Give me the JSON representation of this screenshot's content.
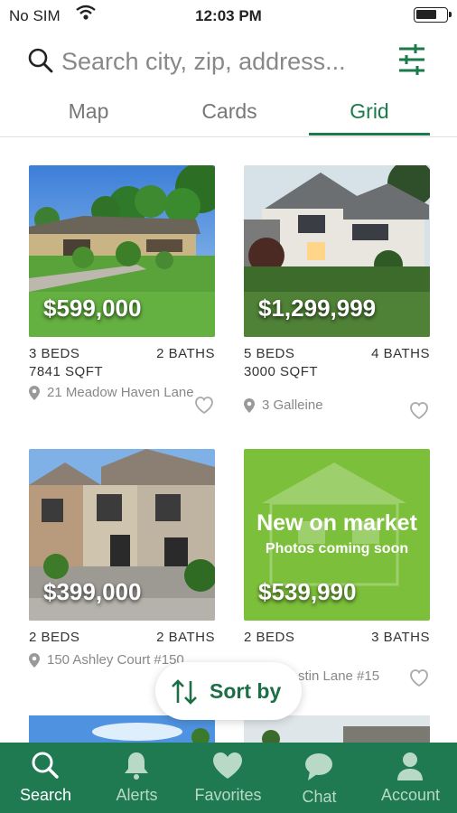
{
  "status_bar": {
    "carrier": "No SIM",
    "time": "12:03 PM"
  },
  "search": {
    "placeholder": "Search city, zip, address..."
  },
  "tabs": [
    {
      "label": "Map",
      "active": false
    },
    {
      "label": "Cards",
      "active": false
    },
    {
      "label": "Grid",
      "active": true
    }
  ],
  "listings": [
    {
      "price": "$599,000",
      "beds": "3 BEDS",
      "baths": "2 BATHS",
      "sqft": "7841 SQFT",
      "address": "21 Meadow Haven Lane"
    },
    {
      "price": "$1,299,999",
      "beds": "5 BEDS",
      "baths": "4 BATHS",
      "sqft": "3000 SQFT",
      "address": "3 Galleine"
    },
    {
      "price": "$399,000",
      "beds": "2 BEDS",
      "baths": "2 BATHS",
      "sqft": "",
      "address": "150 Ashley Court #150"
    },
    {
      "price": "$539,990",
      "beds": "2 BEDS",
      "baths": "3 BATHS",
      "sqft": "",
      "address": "stin Lane #15",
      "overlay_title": "New on market",
      "overlay_subtitle": "Photos coming soon"
    }
  ],
  "sort_button": {
    "label": "Sort by"
  },
  "bottom_nav": [
    {
      "label": "Search",
      "icon": "search-icon",
      "active": true
    },
    {
      "label": "Alerts",
      "icon": "bell-icon",
      "active": false
    },
    {
      "label": "Favorites",
      "icon": "heart-icon",
      "active": false
    },
    {
      "label": "Chat",
      "icon": "chat-icon",
      "active": false
    },
    {
      "label": "Account",
      "icon": "person-icon",
      "active": false
    }
  ],
  "colors": {
    "accent": "#1b7a4b",
    "nav_bg": "#1f7a52",
    "new_on_market_bg": "#7cbf3a"
  }
}
